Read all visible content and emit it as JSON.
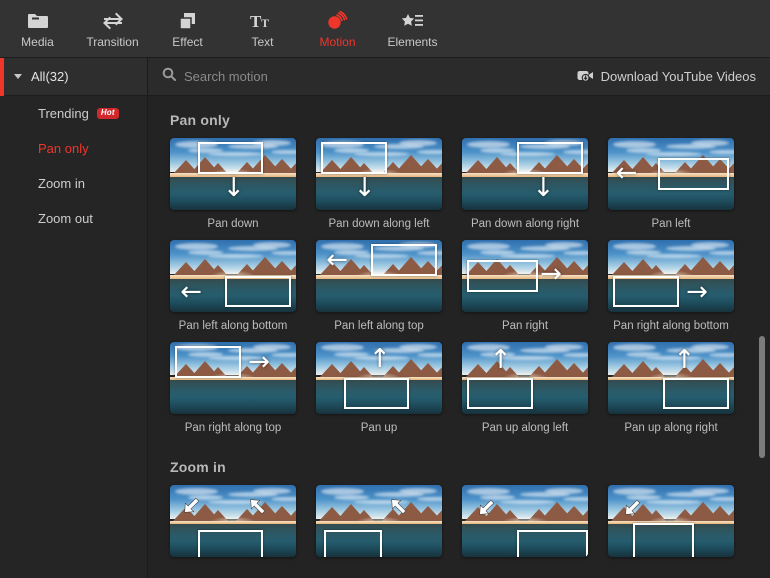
{
  "toolbar": {
    "items": [
      {
        "label": "Media",
        "icon": "folder-icon",
        "active": false
      },
      {
        "label": "Transition",
        "icon": "transition-icon",
        "active": false
      },
      {
        "label": "Effect",
        "icon": "effect-icon",
        "active": false
      },
      {
        "label": "Text",
        "icon": "text-icon",
        "active": false
      },
      {
        "label": "Motion",
        "icon": "motion-icon",
        "active": true
      },
      {
        "label": "Elements",
        "icon": "elements-icon",
        "active": false
      }
    ]
  },
  "search": {
    "placeholder": "Search motion",
    "value": "",
    "icon": "search-icon"
  },
  "youtube": {
    "label": "Download YouTube Videos",
    "icon": "video-download-icon"
  },
  "sidebar": {
    "header": {
      "label": "All(32)",
      "icon": "chevron-down-icon"
    },
    "items": [
      {
        "label": "Trending",
        "badge": "Hot",
        "selected": false
      },
      {
        "label": "Pan only",
        "badge": "",
        "selected": true
      },
      {
        "label": "Zoom in",
        "badge": "",
        "selected": false
      },
      {
        "label": "Zoom out",
        "badge": "",
        "selected": false
      }
    ]
  },
  "colors": {
    "accent": "#f0352b",
    "badge": "#d2272b",
    "toolbar_bg": "#333333",
    "panel_bg": "#252525",
    "content_bg": "#232323"
  },
  "sections": [
    {
      "title": "Pan only",
      "items": [
        {
          "label": "Pan down",
          "rect": "top-center",
          "arrow": "down",
          "arrow_pos": "bottom-center"
        },
        {
          "label": "Pan down along left",
          "rect": "top-left",
          "arrow": "down",
          "arrow_pos": "bottom-left-mid"
        },
        {
          "label": "Pan down along right",
          "rect": "top-right",
          "arrow": "down",
          "arrow_pos": "bottom-right-mid"
        },
        {
          "label": "Pan left",
          "rect": "mid-right",
          "arrow": "left",
          "arrow_pos": "mid-left"
        },
        {
          "label": "Pan left along bottom",
          "rect": "bottom-right",
          "arrow": "left",
          "arrow_pos": "bottom-left"
        },
        {
          "label": "Pan left along top",
          "rect": "top-right",
          "arrow": "left",
          "arrow_pos": "top-left"
        },
        {
          "label": "Pan right",
          "rect": "mid-left",
          "arrow": "right",
          "arrow_pos": "mid-right"
        },
        {
          "label": "Pan right along bottom",
          "rect": "bottom-left",
          "arrow": "right",
          "arrow_pos": "bottom-right"
        },
        {
          "label": "Pan right along top",
          "rect": "top-left",
          "arrow": "right",
          "arrow_pos": "top-right"
        },
        {
          "label": "Pan up",
          "rect": "bottom-center",
          "arrow": "up",
          "arrow_pos": "top-center"
        },
        {
          "label": "Pan up along left",
          "rect": "bottom-left",
          "arrow": "up",
          "arrow_pos": "top-left-mid"
        },
        {
          "label": "Pan up along right",
          "rect": "bottom-right",
          "arrow": "up",
          "arrow_pos": "top-right-mid"
        }
      ]
    },
    {
      "title": "Zoom in",
      "items": [
        {
          "label": "",
          "rect": "zoom-center",
          "arrow": "zoom-in-both",
          "arrow_pos": ""
        },
        {
          "label": "",
          "rect": "zoom-left",
          "arrow": "zoom-in-right",
          "arrow_pos": ""
        },
        {
          "label": "",
          "rect": "zoom-right",
          "arrow": "zoom-in-left",
          "arrow_pos": ""
        },
        {
          "label": "",
          "rect": "zoom-center-left",
          "arrow": "zoom-in-left",
          "arrow_pos": ""
        }
      ]
    }
  ],
  "scrollbar": {
    "name": "content-scrollbar"
  }
}
